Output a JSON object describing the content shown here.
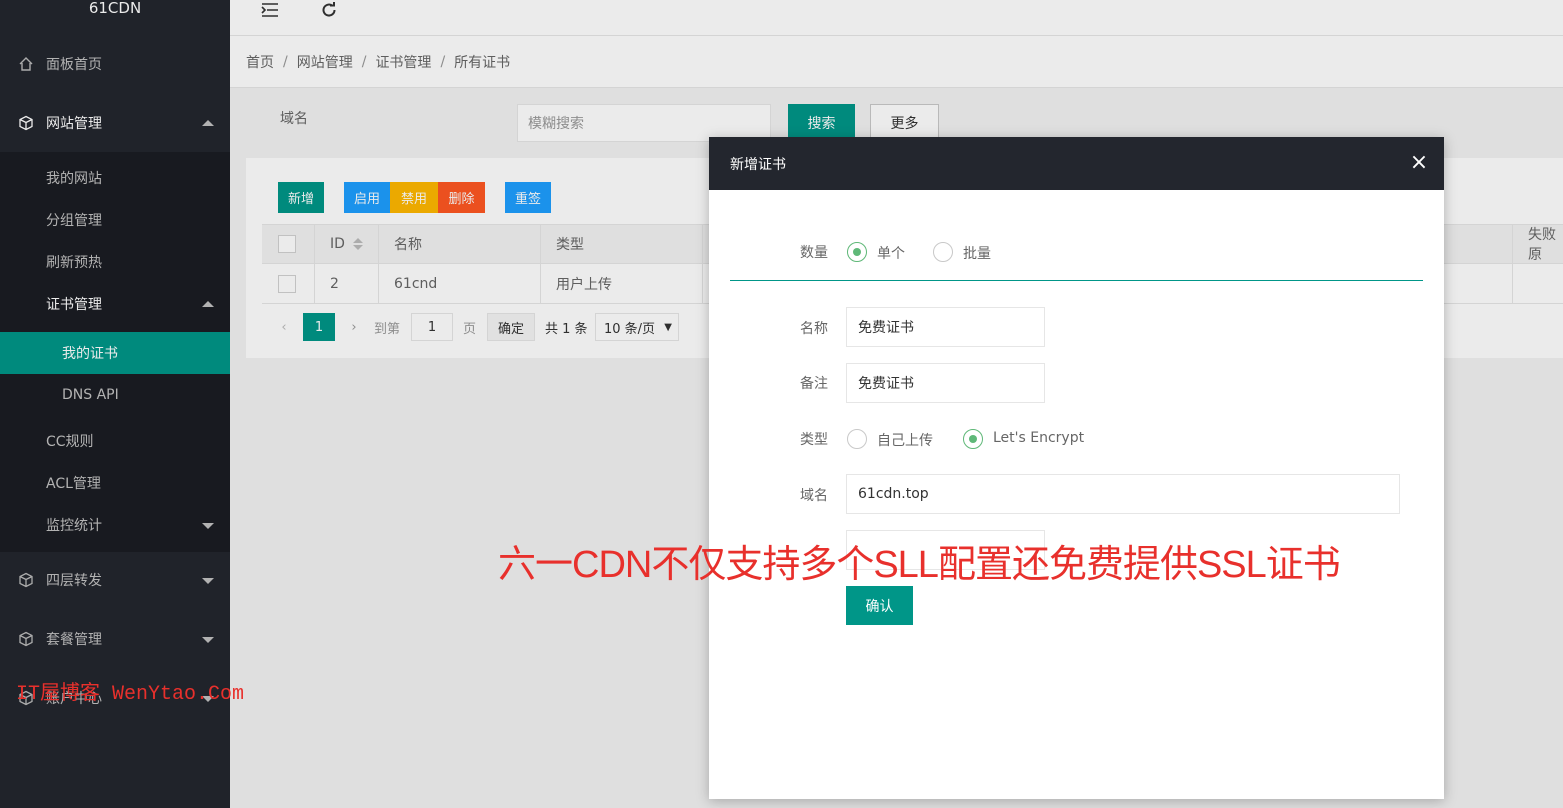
{
  "app": {
    "logo": "61CDN"
  },
  "sidebar": {
    "items": [
      {
        "label": "面板首页",
        "icon": "home-icon"
      },
      {
        "label": "网站管理",
        "icon": "cube-icon",
        "expanded": true
      },
      {
        "label": "四层转发",
        "icon": "cube-icon"
      },
      {
        "label": "套餐管理",
        "icon": "cube-icon"
      },
      {
        "label": "账户中心",
        "icon": "cube-icon"
      }
    ],
    "website_sub": [
      "我的网站",
      "分组管理",
      "刷新预热",
      "证书管理"
    ],
    "cert_sub": [
      "我的证书",
      "DNS API"
    ],
    "website_sub2": [
      "CC规则",
      "ACL管理",
      "监控统计"
    ]
  },
  "header": {
    "menu_icon": "menu-collapse-icon",
    "refresh_icon": "refresh-icon"
  },
  "breadcrumb": [
    "首页",
    "网站管理",
    "证书管理",
    "所有证书"
  ],
  "search": {
    "label": "域名",
    "placeholder": "模糊搜索",
    "search_button": "搜索",
    "more_button": "更多"
  },
  "toolbar": {
    "add": "新增",
    "enable": "启用",
    "disable": "禁用",
    "delete": "删除",
    "resign": "重签"
  },
  "table": {
    "columns": [
      "ID",
      "名称",
      "类型",
      "失败原"
    ],
    "rows": [
      {
        "id": "2",
        "name": "61cnd",
        "type": "用户上传"
      }
    ]
  },
  "pagination": {
    "current_page": "1",
    "goto_label": "到第",
    "goto_value": "1",
    "page_unit": "页",
    "confirm": "确定",
    "total": "共 1 条",
    "page_size": "10 条/页"
  },
  "modal": {
    "title": "新增证书",
    "quantity_label": "数量",
    "quantity_options": [
      "单个",
      "批量"
    ],
    "name_label": "名称",
    "name_value": "免费证书",
    "remark_label": "备注",
    "remark_value": "免费证书",
    "type_label": "类型",
    "type_options": [
      "自己上传",
      "Let's Encrypt"
    ],
    "domain_label": "域名",
    "domain_value": "61cdn.top",
    "confirm_button": "确认"
  },
  "overlay_text": {
    "banner": "六一CDN不仅支持多个SLL配置还免费提供SSL证书",
    "watermark": "IT屋博客 WenYtao.Com"
  },
  "colors": {
    "primary": "#009688",
    "sidebar": "#23262e",
    "enable": "#1e9fff",
    "disable": "#ffb800",
    "delete": "#ff5722",
    "radio_on": "#5fb878",
    "banner": "#e8302c"
  }
}
